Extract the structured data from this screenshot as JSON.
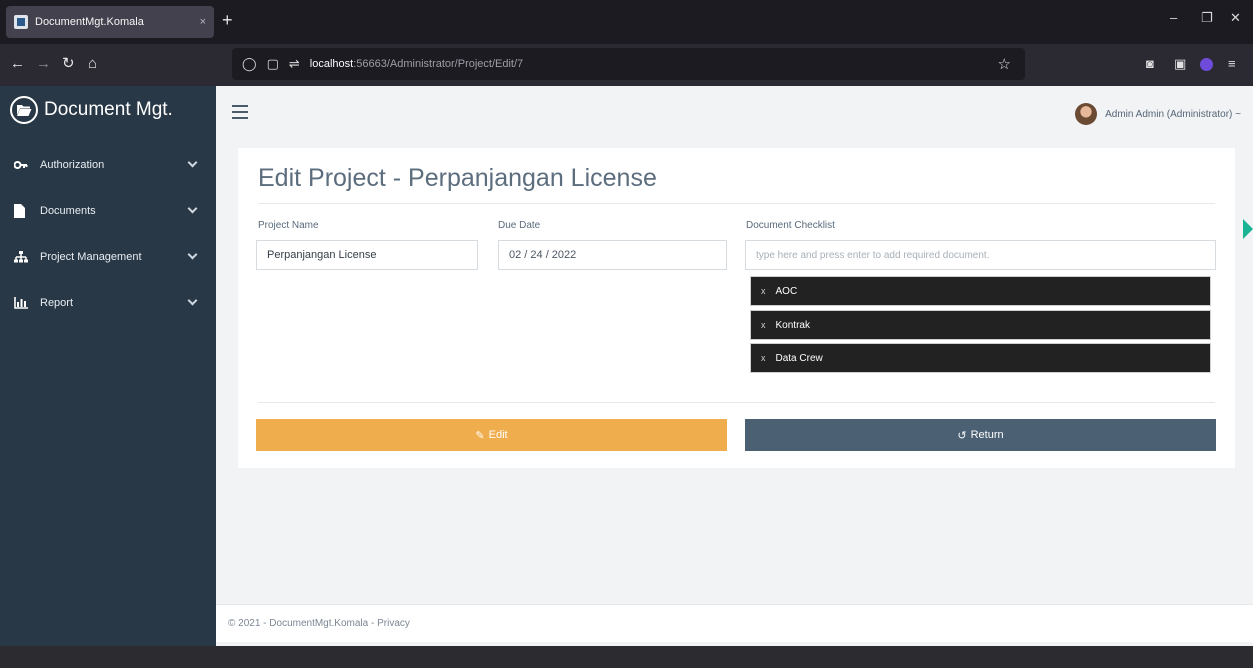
{
  "browser": {
    "tab_title": "DocumentMgt.Komala",
    "tab_close": "×",
    "new_tab": "+",
    "window_controls": {
      "minimize": "–",
      "maximize": "❐",
      "close": "✕"
    },
    "url_host": "localhost",
    "url_path": ":56663/Administrator/Project/Edit/7"
  },
  "brand": {
    "name": "Document Mgt."
  },
  "sidebar": {
    "items": [
      {
        "label": "Authorization",
        "icon": "key-icon"
      },
      {
        "label": "Documents",
        "icon": "file-icon"
      },
      {
        "label": "Project Management",
        "icon": "sitemap-icon"
      },
      {
        "label": "Report",
        "icon": "bar-chart-icon"
      }
    ]
  },
  "header": {
    "user": "Admin Admin (Administrator) ~"
  },
  "page": {
    "title": "Edit Project - Perpanjangan License",
    "project_name_label": "Project Name",
    "project_name_value": "Perpanjangan License",
    "due_date_label": "Due Date",
    "due_date_value": "02 / 24 / 2022",
    "checklist_label": "Document Checklist",
    "checklist_placeholder": "type here and press enter to add required document.",
    "checklist_items": [
      {
        "remove": "x",
        "label": "AOC"
      },
      {
        "remove": "x",
        "label": "Kontrak"
      },
      {
        "remove": "x",
        "label": "Data Crew"
      }
    ],
    "edit_button": "Edit",
    "return_button": "Return"
  },
  "footer": {
    "text": "© 2021 - DocumentMgt.Komala - Privacy"
  },
  "colors": {
    "sidebar": "#293846",
    "edit_button": "#f0ad4e",
    "return_button": "#4b6173",
    "accent": "#1ab394"
  }
}
